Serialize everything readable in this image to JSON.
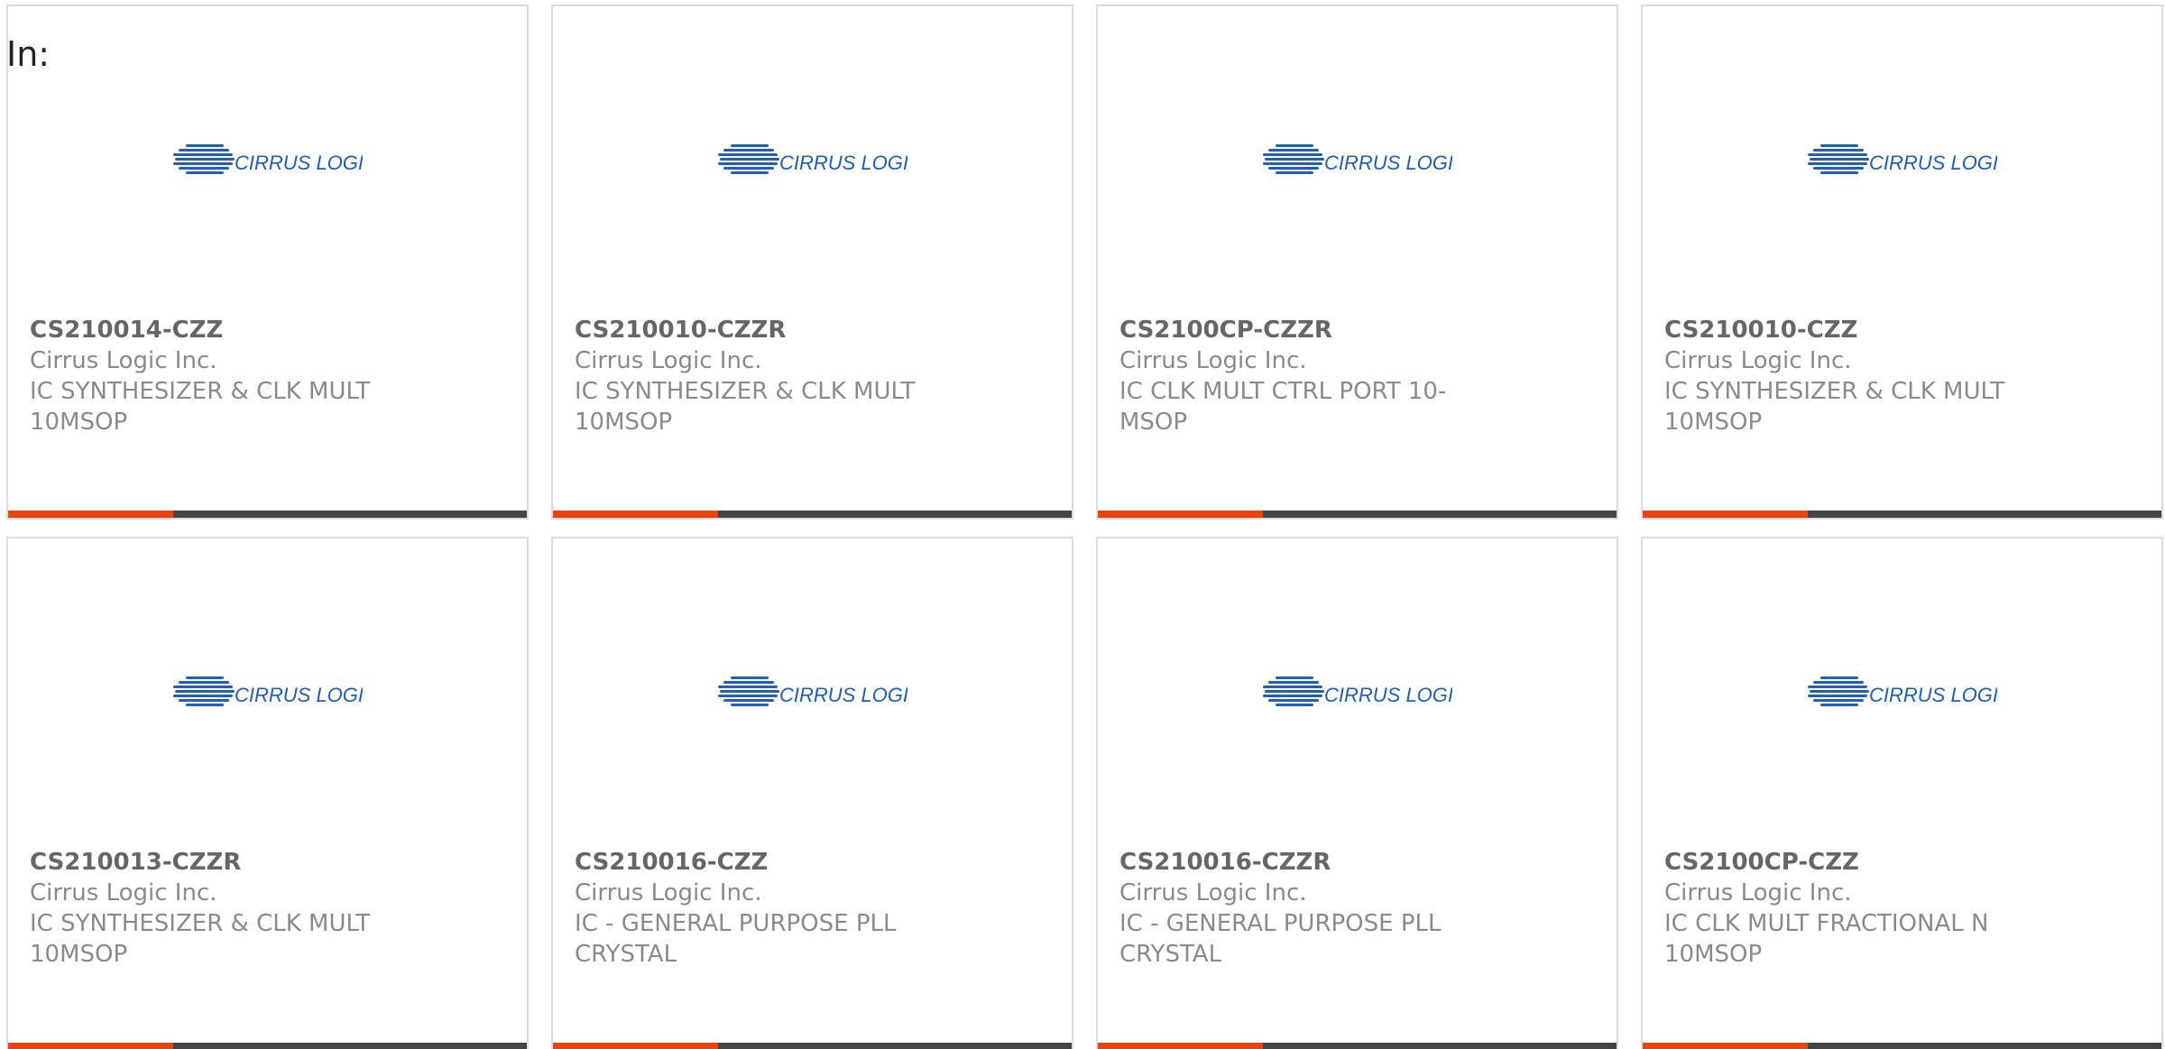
{
  "filter_label": "In:",
  "logo_text": "CIRRUS LOGIC",
  "colors": {
    "accent": "#e8420f",
    "bar": "#444444",
    "logo_blue": "#1f5fb4"
  },
  "products": [
    {
      "part_number": "CS210014-CZZ",
      "manufacturer": "Cirrus Logic Inc.",
      "description": "IC SYNTHESIZER & CLK MULT 10MSOP"
    },
    {
      "part_number": "CS210010-CZZR",
      "manufacturer": "Cirrus Logic Inc.",
      "description": "IC SYNTHESIZER & CLK MULT 10MSOP"
    },
    {
      "part_number": "CS2100CP-CZZR",
      "manufacturer": "Cirrus Logic Inc.",
      "description": "IC CLK MULT CTRL PORT 10-MSOP"
    },
    {
      "part_number": "CS210010-CZZ",
      "manufacturer": "Cirrus Logic Inc.",
      "description": "IC SYNTHESIZER & CLK MULT 10MSOP"
    },
    {
      "part_number": "CS210013-CZZR",
      "manufacturer": "Cirrus Logic Inc.",
      "description": "IC SYNTHESIZER & CLK MULT 10MSOP"
    },
    {
      "part_number": "CS210016-CZZ",
      "manufacturer": "Cirrus Logic Inc.",
      "description": "IC - GENERAL PURPOSE PLL CRYSTAL"
    },
    {
      "part_number": "CS210016-CZZR",
      "manufacturer": "Cirrus Logic Inc.",
      "description": "IC - GENERAL PURPOSE PLL CRYSTAL"
    },
    {
      "part_number": "CS2100CP-CZZ",
      "manufacturer": "Cirrus Logic Inc.",
      "description": "IC CLK MULT FRACTIONAL N 10MSOP"
    }
  ]
}
